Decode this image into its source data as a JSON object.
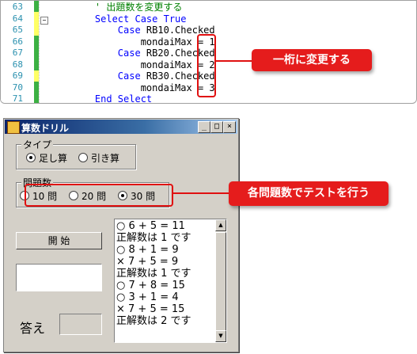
{
  "editor": {
    "line_numbers": [
      "63",
      "64",
      "65",
      "66",
      "67",
      "68",
      "69",
      "70",
      "71"
    ],
    "lines": [
      {
        "indent": "    ",
        "parts": [
          {
            "t": "' 出題数を変更する",
            "c": "cm"
          }
        ]
      },
      {
        "indent": "    ",
        "parts": [
          {
            "t": "Select Case ",
            "c": "kw"
          },
          {
            "t": "True",
            "c": "kw"
          }
        ]
      },
      {
        "indent": "        ",
        "parts": [
          {
            "t": "Case ",
            "c": "kw"
          },
          {
            "t": "RB10.Checked",
            "c": ""
          }
        ]
      },
      {
        "indent": "            ",
        "parts": [
          {
            "t": "mondaiMax = 1",
            "c": ""
          }
        ]
      },
      {
        "indent": "        ",
        "parts": [
          {
            "t": "Case ",
            "c": "kw"
          },
          {
            "t": "RB20.Checked",
            "c": ""
          }
        ]
      },
      {
        "indent": "            ",
        "parts": [
          {
            "t": "mondaiMax = 2",
            "c": ""
          }
        ]
      },
      {
        "indent": "        ",
        "parts": [
          {
            "t": "Case ",
            "c": "kw"
          },
          {
            "t": "RB30.Checked",
            "c": ""
          }
        ]
      },
      {
        "indent": "            ",
        "parts": [
          {
            "t": "mondaiMax = 3",
            "c": ""
          }
        ]
      },
      {
        "indent": "    ",
        "parts": [
          {
            "t": "End Select",
            "c": "kw"
          }
        ]
      }
    ]
  },
  "callouts": {
    "digit_change": "一桁に変更する",
    "test_by_count": "各問題数でテストを行う"
  },
  "window": {
    "title": "算数ドリル",
    "minimize_glyph": "_",
    "maximize_glyph": "□",
    "close_glyph": "×",
    "type_group": {
      "label": "タイプ",
      "options": [
        "足し算",
        "引き算"
      ],
      "selected_index": 0
    },
    "count_group": {
      "label": "問題数",
      "options": [
        "10 問",
        "20 問",
        "30 問"
      ],
      "selected_index": 2
    },
    "start_button": "開 始",
    "question_value": "",
    "answer_label": "答え",
    "answer_value": "",
    "log": [
      "○ 6 + 5 = 11",
      "正解数は 1 です",
      "○ 8 + 1 = 9",
      "× 7 + 5 = 9",
      "正解数は 1 です",
      "○ 7 + 8 = 15",
      "○ 3 + 1 = 4",
      "× 7 + 5 = 15",
      "正解数は 2 です"
    ]
  },
  "colors": {
    "callout": "#e51c1c",
    "keyword": "#0000ff",
    "comment": "#008000",
    "line_number": "#2b91af",
    "window_face": "#d4d0c8"
  },
  "icons": {
    "app": "calculator-app-icon",
    "scroll_up": "triangle-up-icon",
    "scroll_down": "triangle-down-icon"
  }
}
